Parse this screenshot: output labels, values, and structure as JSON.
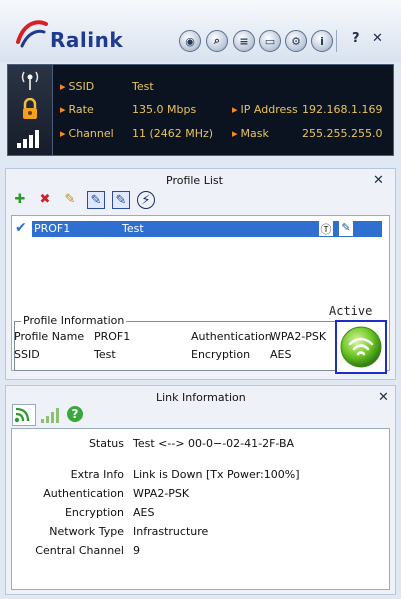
{
  "header": {
    "brand": "Ralink",
    "toolbar": [
      {
        "name": "survey-icon",
        "glyph": "◉"
      },
      {
        "name": "scan-icon",
        "glyph": "⌕"
      },
      {
        "name": "list-icon",
        "glyph": "≡"
      },
      {
        "name": "page-icon",
        "glyph": "▭"
      },
      {
        "name": "settings-icon",
        "glyph": "⚙"
      },
      {
        "name": "info-icon",
        "glyph": "i"
      }
    ],
    "help": "?",
    "close": "✕"
  },
  "status": {
    "ssid_label": "SSID",
    "ssid_value": "Test",
    "rate_label": "Rate",
    "rate_value": "135.0 Mbps",
    "channel_label": "Channel",
    "channel_value": "11 (2462 MHz)",
    "ip_label": "IP Address",
    "ip_value": "192.168.1.169",
    "mask_label": "Mask",
    "mask_value": "255.255.255.0"
  },
  "profile_list": {
    "title": "Profile List",
    "close": "✕",
    "rows": [
      {
        "name": "PROF1",
        "ssid": "Test"
      }
    ],
    "info_title": "Profile Information",
    "profile_name_label": "Profile Name",
    "profile_name_value": "PROF1",
    "ssid_label": "SSID",
    "ssid_value": "Test",
    "auth_label": "Authentication",
    "auth_value": "WPA2-PSK",
    "enc_label": "Encryption",
    "enc_value": "AES",
    "active_label": "Active"
  },
  "link_info": {
    "title": "Link Information",
    "close": "✕",
    "status_label": "Status",
    "status_value": "Test <--> 00-0−-02-41-2F-BA",
    "extra_label": "Extra Info",
    "extra_value": "Link is Down  [Tx Power:100%]",
    "auth_label": "Authentication",
    "auth_value": "WPA2-PSK",
    "enc_label": "Encryption",
    "enc_value": "AES",
    "net_label": "Network Type",
    "net_value": "Infrastructure",
    "ch_label": "Central Channel",
    "ch_value": "9"
  },
  "colors": {
    "accent": "#2e6fd0",
    "status_text": "#e8c45a",
    "status_bg": "#0c1320"
  }
}
